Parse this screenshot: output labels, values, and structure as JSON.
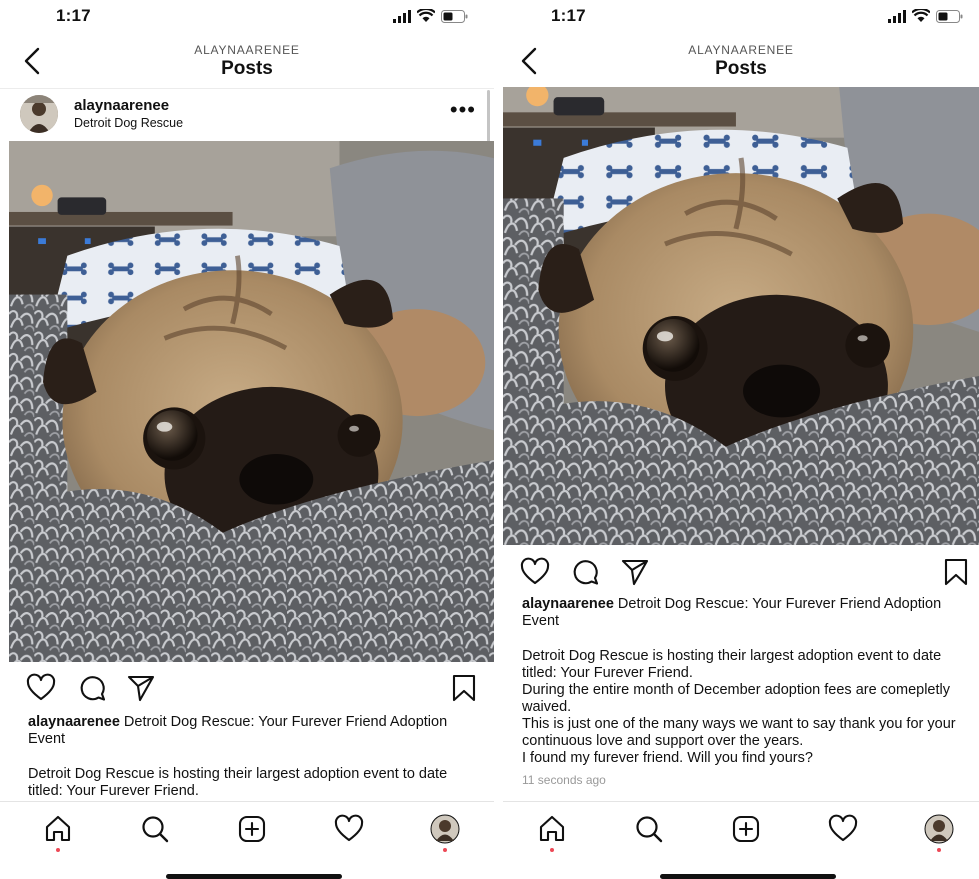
{
  "colors": {
    "accent_dot": "#ed4956",
    "text": "#111111",
    "muted": "#999999"
  },
  "screens": [
    {
      "status": {
        "time": "1:17"
      },
      "header": {
        "account": "ALAYNAARENEE",
        "title": "Posts"
      },
      "post": {
        "username": "alaynaarenee",
        "location": "Detroit Dog Rescue",
        "caption_user": "alaynaarenee",
        "caption_title": " Detroit Dog Rescue: Your Furever Friend Adoption Event",
        "body_lines": [
          "Detroit Dog Rescue is hosting their largest adoption event to date titled: Your Furever Friend."
        ]
      }
    },
    {
      "status": {
        "time": "1:17"
      },
      "header": {
        "account": "ALAYNAARENEE",
        "title": "Posts"
      },
      "post": {
        "caption_user": "alaynaarenee",
        "caption_title": " Detroit Dog Rescue: Your Furever Friend Adoption Event",
        "body_lines": [
          "Detroit Dog Rescue is hosting their largest adoption event to date titled: Your Furever Friend.",
          "During the entire month of December adoption fees are comepletly waived.",
          "This is just one of the many ways we want to say thank you for your continuous love and support over the years.",
          "I found my furever friend. Will you find yours?"
        ],
        "timestamp": "11 seconds ago"
      }
    }
  ],
  "icons": {
    "back": "chevron-left-icon",
    "more": "more-horizontal-icon",
    "like": "heart-icon",
    "comment": "comment-icon",
    "share": "send-icon",
    "save": "bookmark-icon",
    "home": "home-icon",
    "search": "search-icon",
    "create": "add-post-icon",
    "activity": "heart-icon",
    "profile": "avatar"
  }
}
